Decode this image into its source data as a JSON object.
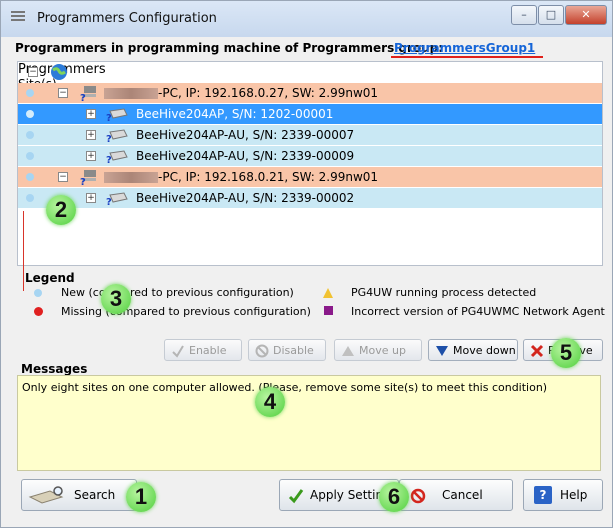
{
  "window": {
    "title": "Programmers Configuration",
    "controls": {
      "minimize": "–",
      "maximize": "□",
      "close": "✕"
    }
  },
  "header": {
    "label": "Programmers in programming machine of Programmers group:",
    "group_link": "ProgrammersGroup1"
  },
  "tree": {
    "root_label": "Programmers",
    "sites_column": "Site(s)",
    "rows": [
      {
        "kind": "pc",
        "text": "-PC, IP: 192.168.0.27, SW: 2.99nw01"
      },
      {
        "kind": "programmer",
        "text": "BeeHive204AP, S/N: 1202-00001",
        "selected": true
      },
      {
        "kind": "programmer",
        "text": "BeeHive204AP-AU, S/N: 2339-00007"
      },
      {
        "kind": "programmer",
        "text": "BeeHive204AP-AU, S/N: 2339-00009"
      },
      {
        "kind": "pc",
        "text": "-PC, IP: 192.168.0.21, SW: 2.99nw01"
      },
      {
        "kind": "programmer",
        "text": "BeeHive204AP-AU, S/N: 2339-00002"
      }
    ]
  },
  "legend": {
    "title": "Legend",
    "new": "New (compared to previous configuration)",
    "missing": "Missing (compared to previous configuration)",
    "running": "PG4UW running process detected",
    "incorrect": "Incorrect version of PG4UWMC Network Agent"
  },
  "actions": {
    "enable": "Enable",
    "disable": "Disable",
    "move_up": "Move up",
    "move_down": "Move down",
    "remove": "Remove"
  },
  "messages": {
    "title": "Messages",
    "text": "Only eight sites on one computer allowed. (Please, remove some site(s) to meet this condition)"
  },
  "footer": {
    "search": "Search",
    "apply": "Apply Settings",
    "cancel": "Cancel",
    "help": "Help"
  },
  "callouts": [
    "1",
    "2",
    "3",
    "4",
    "5",
    "6"
  ],
  "colors": {
    "pc_row": "#f9c5a8",
    "programmer_row": "#c9e8f4",
    "selected_row": "#3399ff",
    "messages_bg": "#ffffcc",
    "callout": "#4fcf3c",
    "link": "#1565d8"
  }
}
